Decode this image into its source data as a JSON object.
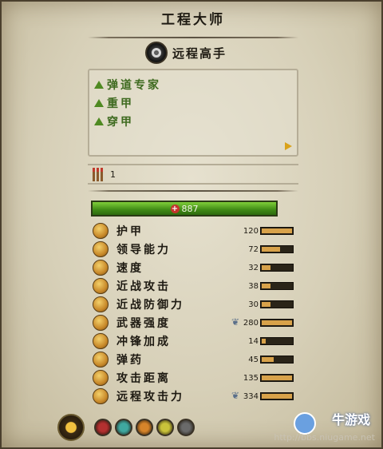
{
  "title": "工程大师",
  "unit_type": {
    "label": "远程高手",
    "icon": "ranged-ring-icon"
  },
  "attributes": [
    {
      "label": "弹道专家",
      "icon": "green-triangle-icon"
    },
    {
      "label": "重甲",
      "icon": "green-triangle-icon"
    },
    {
      "label": "穿甲",
      "icon": "green-triangle-icon"
    }
  ],
  "ammo": {
    "icon": "arrow-bundle-icon",
    "count": "1"
  },
  "health": {
    "icon": "health-cross-icon",
    "value": "887"
  },
  "stats": [
    {
      "label": "护甲",
      "value": "120",
      "level": 1.0,
      "icon": "armor-icon",
      "badge": ""
    },
    {
      "label": "领导能力",
      "value": "72",
      "level": 0.6,
      "icon": "leadership-icon",
      "badge": ""
    },
    {
      "label": "速度",
      "value": "32",
      "level": 0.3,
      "icon": "speed-icon",
      "badge": ""
    },
    {
      "label": "近战攻击",
      "value": "38",
      "level": 0.3,
      "icon": "melee-attack-icon",
      "badge": ""
    },
    {
      "label": "近战防御力",
      "value": "30",
      "level": 0.3,
      "icon": "melee-defense-icon",
      "badge": ""
    },
    {
      "label": "武器强度",
      "value": "280",
      "level": 1.0,
      "icon": "weapon-strength-icon",
      "badge": "wings-icon"
    },
    {
      "label": "冲锋加成",
      "value": "14",
      "level": 0.12,
      "icon": "charge-bonus-icon",
      "badge": ""
    },
    {
      "label": "弹药",
      "value": "45",
      "level": 0.4,
      "icon": "ammo-icon",
      "badge": ""
    },
    {
      "label": "攻击距离",
      "value": "135",
      "level": 1.0,
      "icon": "range-icon",
      "badge": ""
    },
    {
      "label": "远程攻击力",
      "value": "334",
      "level": 1.0,
      "icon": "ranged-attack-icon",
      "badge": "wings-icon"
    }
  ],
  "bottom_abilities": [
    {
      "icon": "main-ability-icon",
      "color": "#f2c140"
    },
    {
      "icon": "demon-face-icon",
      "color": "#b33030"
    },
    {
      "icon": "cyan-skull-icon",
      "color": "#3fa8a0"
    },
    {
      "icon": "hand-icon",
      "color": "#d6842a"
    },
    {
      "icon": "eye-icon",
      "color": "#c9c23a"
    },
    {
      "icon": "cluster-icon",
      "color": "#6a6a6a"
    }
  ],
  "watermark": {
    "site": "牛游戏",
    "url": "http://bbs.niugame.net"
  },
  "colors": {
    "health": "#4f9a1f",
    "attribute_text": "#3e6a1f",
    "bar_fill": "#d8a24a"
  }
}
